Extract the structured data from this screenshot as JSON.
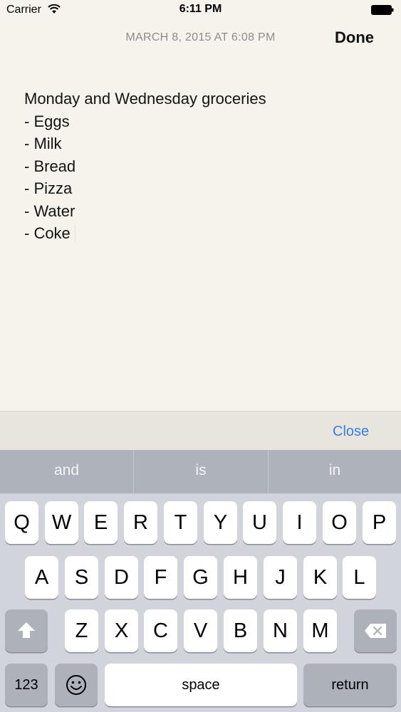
{
  "status_bar": {
    "carrier": "Carrier",
    "time": "6:11 PM"
  },
  "note": {
    "date": "MARCH 8, 2015 AT 6:08 PM",
    "done_label": "Done",
    "lines": [
      "Monday and Wednesday groceries",
      "- Eggs",
      "- Milk",
      "- Bread",
      "- Pizza",
      "- Water",
      "- Coke"
    ]
  },
  "accessory": {
    "close_label": "Close"
  },
  "suggestions": [
    "and",
    "is",
    "in"
  ],
  "keyboard": {
    "row1": [
      "Q",
      "W",
      "E",
      "R",
      "T",
      "Y",
      "U",
      "I",
      "O",
      "P"
    ],
    "row2": [
      "A",
      "S",
      "D",
      "F",
      "G",
      "H",
      "J",
      "K",
      "L"
    ],
    "row3": [
      "Z",
      "X",
      "C",
      "V",
      "B",
      "N",
      "M"
    ],
    "numbers_label": "123",
    "space_label": "space",
    "return_label": "return",
    "icons": {
      "shift": "shift-icon",
      "backspace": "backspace-icon",
      "emoji": "emoji-icon"
    }
  }
}
